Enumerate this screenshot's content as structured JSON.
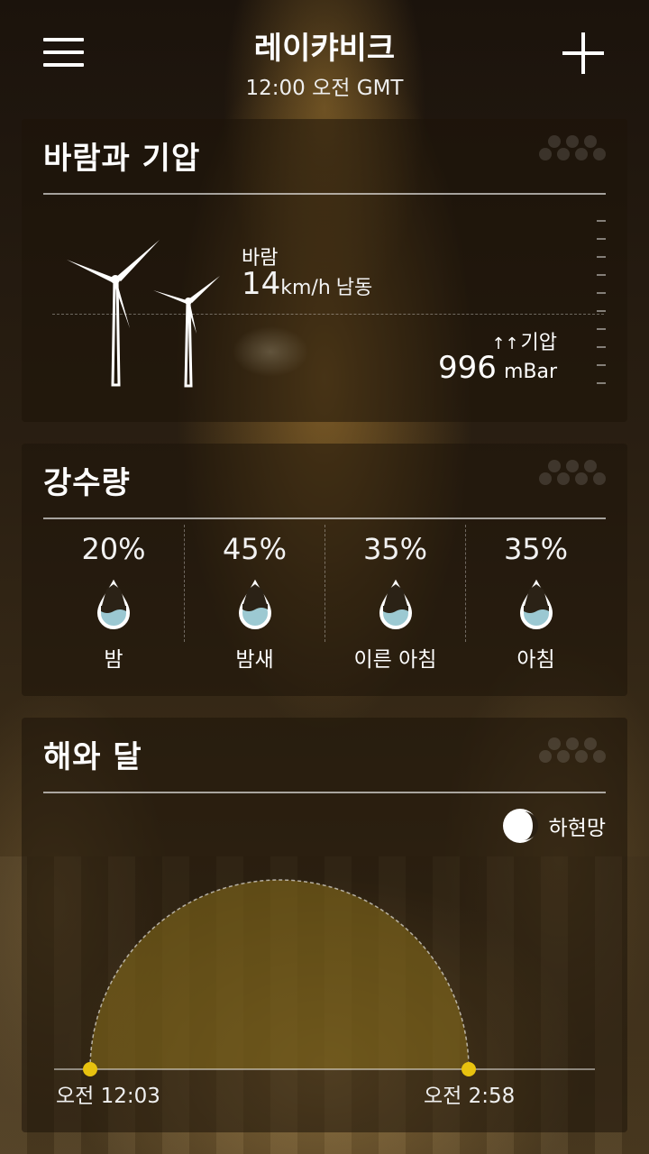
{
  "header": {
    "city": "레이캬비크",
    "time": "12:00 오전 GMT",
    "menu_icon": "hamburger-menu-icon",
    "add_icon": "plus-icon"
  },
  "wind_card": {
    "title": "바람과 기압",
    "wind_label": "바람",
    "wind_speed": "14",
    "wind_unit": "km/h",
    "wind_direction": "남동",
    "pressure_label": "기압",
    "pressure_trend_icon": "rising-arrows-icon",
    "pressure_arrows": "↑↑",
    "pressure_value": "996",
    "pressure_unit": "mBar"
  },
  "precip_card": {
    "title": "강수량",
    "periods": [
      {
        "percent": "20%",
        "label": "밤"
      },
      {
        "percent": "45%",
        "label": "밤새"
      },
      {
        "percent": "35%",
        "label": "이른 아침"
      },
      {
        "percent": "35%",
        "label": "아침"
      }
    ]
  },
  "sun_card": {
    "title": "해와 달",
    "moon_phase": "하현망",
    "sunrise": "오전 12:03",
    "sunset": "오전 2:58"
  },
  "colors": {
    "sun_dot": "#e8c20f",
    "water": "#a9dce8",
    "sun_arc_fill": "#8a6f1c"
  }
}
